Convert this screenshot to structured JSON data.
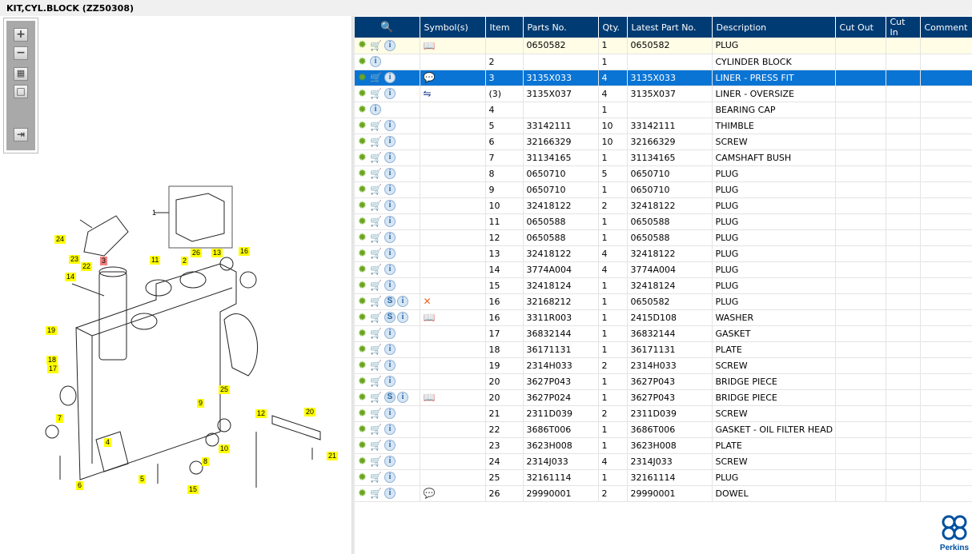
{
  "title": "KIT,CYL.BLOCK (ZZ50308)",
  "toolbar": {
    "zoom_in": "+",
    "zoom_out": "−",
    "fit": "▦",
    "actual": "□",
    "export": "⇥"
  },
  "diagram": {
    "callouts": [
      "1",
      "24",
      "23",
      "22",
      "3",
      "11",
      "2",
      "26",
      "13",
      "16",
      "14",
      "19",
      "18",
      "17",
      "7",
      "4",
      "25",
      "9",
      "12",
      "20",
      "21",
      "10",
      "8",
      "5",
      "15",
      "6"
    ]
  },
  "table": {
    "columns": [
      "",
      "Symbol(s)",
      "Item",
      "Parts No.",
      "Qty.",
      "Latest Part No.",
      "Description",
      "Cut Out",
      "Cut In",
      "Comment"
    ],
    "rows": [
      {
        "icons": [
          "gear",
          "cart",
          "info"
        ],
        "symbol": "book-search",
        "item": "",
        "part": "0650582",
        "qty": "1",
        "latest": "0650582",
        "desc": "PLUG"
      },
      {
        "icons": [
          "gear",
          "info"
        ],
        "symbol": "",
        "item": "2",
        "part": "",
        "qty": "1",
        "latest": "",
        "desc": "CYLINDER BLOCK"
      },
      {
        "icons": [
          "gear",
          "cart",
          "info"
        ],
        "symbol": "comment",
        "item": "3",
        "part": "3135X033",
        "qty": "4",
        "latest": "3135X033",
        "desc": "LINER - PRESS FIT"
      },
      {
        "icons": [
          "gear",
          "cart",
          "info"
        ],
        "symbol": "interchange",
        "item": "(3)",
        "part": "3135X037",
        "qty": "4",
        "latest": "3135X037",
        "desc": "LINER - OVERSIZE"
      },
      {
        "icons": [
          "gear",
          "info"
        ],
        "symbol": "",
        "item": "4",
        "part": "",
        "qty": "1",
        "latest": "",
        "desc": "BEARING CAP"
      },
      {
        "icons": [
          "gear",
          "cart",
          "info"
        ],
        "symbol": "",
        "item": "5",
        "part": "33142111",
        "qty": "10",
        "latest": "33142111",
        "desc": "THIMBLE"
      },
      {
        "icons": [
          "gear",
          "cart",
          "info"
        ],
        "symbol": "",
        "item": "6",
        "part": "32166329",
        "qty": "10",
        "latest": "32166329",
        "desc": "SCREW"
      },
      {
        "icons": [
          "gear",
          "cart",
          "info"
        ],
        "symbol": "",
        "item": "7",
        "part": "31134165",
        "qty": "1",
        "latest": "31134165",
        "desc": "CAMSHAFT BUSH"
      },
      {
        "icons": [
          "gear",
          "cart",
          "info"
        ],
        "symbol": "",
        "item": "8",
        "part": "0650710",
        "qty": "5",
        "latest": "0650710",
        "desc": "PLUG"
      },
      {
        "icons": [
          "gear",
          "cart",
          "info"
        ],
        "symbol": "",
        "item": "9",
        "part": "0650710",
        "qty": "1",
        "latest": "0650710",
        "desc": "PLUG"
      },
      {
        "icons": [
          "gear",
          "cart",
          "info"
        ],
        "symbol": "",
        "item": "10",
        "part": "32418122",
        "qty": "2",
        "latest": "32418122",
        "desc": "PLUG"
      },
      {
        "icons": [
          "gear",
          "cart",
          "info"
        ],
        "symbol": "",
        "item": "11",
        "part": "0650588",
        "qty": "1",
        "latest": "0650588",
        "desc": "PLUG"
      },
      {
        "icons": [
          "gear",
          "cart",
          "info"
        ],
        "symbol": "",
        "item": "12",
        "part": "0650588",
        "qty": "1",
        "latest": "0650588",
        "desc": "PLUG"
      },
      {
        "icons": [
          "gear",
          "cart",
          "info"
        ],
        "symbol": "",
        "item": "13",
        "part": "32418122",
        "qty": "4",
        "latest": "32418122",
        "desc": "PLUG"
      },
      {
        "icons": [
          "gear",
          "cart",
          "info"
        ],
        "symbol": "",
        "item": "14",
        "part": "3774A004",
        "qty": "4",
        "latest": "3774A004",
        "desc": "PLUG"
      },
      {
        "icons": [
          "gear",
          "cart",
          "info"
        ],
        "symbol": "",
        "item": "15",
        "part": "32418124",
        "qty": "1",
        "latest": "32418124",
        "desc": "PLUG"
      },
      {
        "icons": [
          "gear",
          "cart",
          "s",
          "info"
        ],
        "symbol": "superseded-x",
        "item": "16",
        "part": "32168212",
        "qty": "1",
        "latest": "0650582",
        "desc": "PLUG"
      },
      {
        "icons": [
          "gear",
          "cart",
          "s",
          "info"
        ],
        "symbol": "book-search",
        "item": "16",
        "part": "3311R003",
        "qty": "1",
        "latest": "2415D108",
        "desc": "WASHER"
      },
      {
        "icons": [
          "gear",
          "cart",
          "info"
        ],
        "symbol": "",
        "item": "17",
        "part": "36832144",
        "qty": "1",
        "latest": "36832144",
        "desc": "GASKET"
      },
      {
        "icons": [
          "gear",
          "cart",
          "info"
        ],
        "symbol": "",
        "item": "18",
        "part": "36171131",
        "qty": "1",
        "latest": "36171131",
        "desc": "PLATE"
      },
      {
        "icons": [
          "gear",
          "cart",
          "info"
        ],
        "symbol": "",
        "item": "19",
        "part": "2314H033",
        "qty": "2",
        "latest": "2314H033",
        "desc": "SCREW"
      },
      {
        "icons": [
          "gear",
          "cart",
          "info"
        ],
        "symbol": "",
        "item": "20",
        "part": "3627P043",
        "qty": "1",
        "latest": "3627P043",
        "desc": "BRIDGE PIECE"
      },
      {
        "icons": [
          "gear",
          "cart",
          "s",
          "info"
        ],
        "symbol": "book-search",
        "item": "20",
        "part": "3627P024",
        "qty": "1",
        "latest": "3627P043",
        "desc": "BRIDGE PIECE"
      },
      {
        "icons": [
          "gear",
          "cart",
          "info"
        ],
        "symbol": "",
        "item": "21",
        "part": "2311D039",
        "qty": "2",
        "latest": "2311D039",
        "desc": "SCREW"
      },
      {
        "icons": [
          "gear",
          "cart",
          "info"
        ],
        "symbol": "",
        "item": "22",
        "part": "3686T006",
        "qty": "1",
        "latest": "3686T006",
        "desc": "GASKET - OIL FILTER HEAD"
      },
      {
        "icons": [
          "gear",
          "cart",
          "info"
        ],
        "symbol": "",
        "item": "23",
        "part": "3623H008",
        "qty": "1",
        "latest": "3623H008",
        "desc": "PLATE"
      },
      {
        "icons": [
          "gear",
          "cart",
          "info"
        ],
        "symbol": "",
        "item": "24",
        "part": "2314J033",
        "qty": "4",
        "latest": "2314J033",
        "desc": "SCREW"
      },
      {
        "icons": [
          "gear",
          "cart",
          "info"
        ],
        "symbol": "",
        "item": "25",
        "part": "32161114",
        "qty": "1",
        "latest": "32161114",
        "desc": "PLUG"
      },
      {
        "icons": [
          "gear",
          "cart",
          "info"
        ],
        "symbol": "comment",
        "item": "26",
        "part": "29990001",
        "qty": "2",
        "latest": "29990001",
        "desc": "DOWEL"
      }
    ]
  },
  "logo": {
    "brand": "Perkins"
  },
  "colors": {
    "header": "#003b73",
    "selected": "#0a74d4",
    "callout": "#ffff00"
  }
}
